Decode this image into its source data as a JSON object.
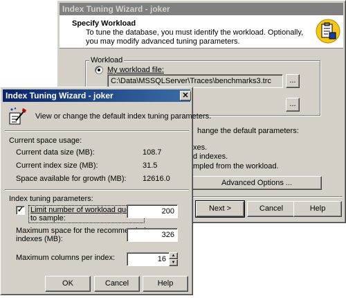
{
  "back_window": {
    "title": "Index Tuning Wizard - joker",
    "header_title": "Specify Workload",
    "header_desc": "To tune the database, you must identify the workload. Optionally, you may modify advanced tuning parameters.",
    "workload_group_label": "Workload",
    "radio_label": "My workload file:",
    "file_path": "C:\\Data\\MSSQLServer\\Traces\\benchmarks3.trc",
    "browse_label": "...",
    "browse2_label": "...",
    "partial_text_1": "hange the default parameters:",
    "partial_text_2": "xes.",
    "partial_text_3": "d indexes.",
    "partial_text_4": "mpled from the workload.",
    "advanced_options_label": "Advanced Options ...",
    "next_label": "Next >",
    "cancel_label": "Cancel",
    "help_label": "Help"
  },
  "front_window": {
    "title": "Index Tuning Wizard - joker",
    "close_glyph": "✕",
    "intro": "View or change the default index tuning parameters.",
    "current_space_heading": "Current space usage:",
    "data_size_label": "Current data size (MB):",
    "data_size_value": "108.7",
    "index_size_label": "Current index size (MB):",
    "index_size_value": "31.5",
    "growth_label": "Space available for growth (MB):",
    "growth_value": "12616.0",
    "params_heading": "Index tuning parameters:",
    "limit_checkbox_checked": true,
    "limit_label_line1": "Limit number of workload queries",
    "limit_label_line2": "to sample:",
    "limit_value": "200",
    "max_space_label_line1": "Maximum space for the recommended",
    "max_space_label_line2": "indexes (MB):",
    "max_space_value": "326",
    "max_columns_label": "Maximum columns per index:",
    "max_columns_value": "16",
    "ok_label": "OK",
    "cancel_label": "Cancel",
    "help_label": "Help"
  },
  "icons": {
    "wizard_icon": "wizard-clipboard-icon",
    "tuning_icon": "tuning-wand-icon",
    "spin_up": "▲",
    "spin_down": "▼"
  },
  "colors": {
    "dialog_face": "#d4d0c8",
    "active_title": "#0a246a",
    "inactive_title": "#808080"
  }
}
